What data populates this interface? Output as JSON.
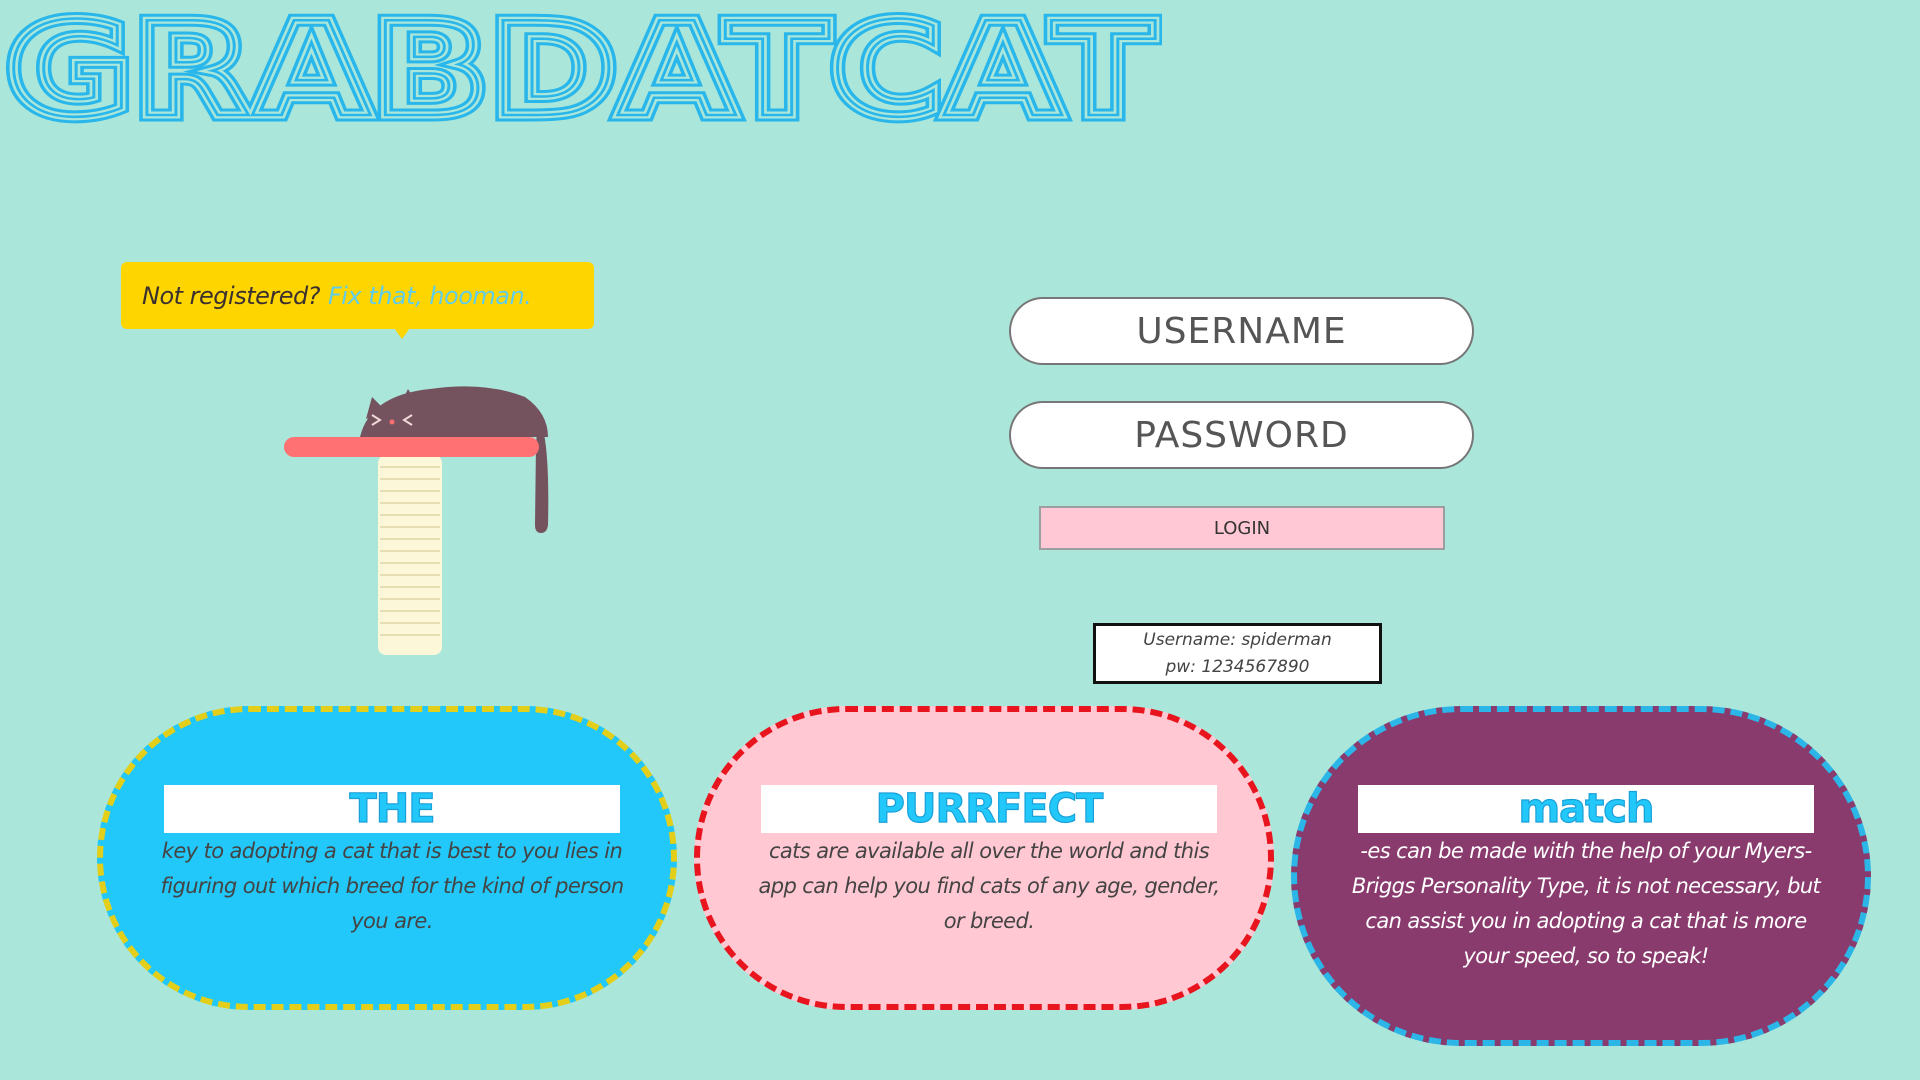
{
  "logo": {
    "text": "GRABDATCAT",
    "color": "#29b6ea"
  },
  "signup_bubble": {
    "prompt": "Not registered?",
    "link_text": "Fix that, hooman.",
    "color": "#ffd500"
  },
  "login": {
    "username_placeholder": "USERNAME",
    "password_placeholder": "PASSWORD",
    "button_label": "LOGIN"
  },
  "credentials_hint": {
    "line1": "Username: spiderman",
    "line2": "pw: 1234567890"
  },
  "info_cards": [
    {
      "heading": "THE",
      "text": "key to adopting a cat that is best to you lies in figuring out which breed for the kind of person you are.",
      "background": "#22c8fa",
      "border": "#e3cf1a"
    },
    {
      "heading": "PURRFECT",
      "text": "cats are available all over the world and this app can help you find cats of any age, gender, or breed.",
      "background": "#ffc8d2",
      "border": "#e8141e"
    },
    {
      "heading": "match",
      "text": "-es can be made with the help of your Myers-Briggs Personality Type, it is not necessary, but can assist you in adopting a cat that is more your speed, so to speak!",
      "background": "#8a3b6e",
      "border": "#2cb6e8"
    }
  ]
}
